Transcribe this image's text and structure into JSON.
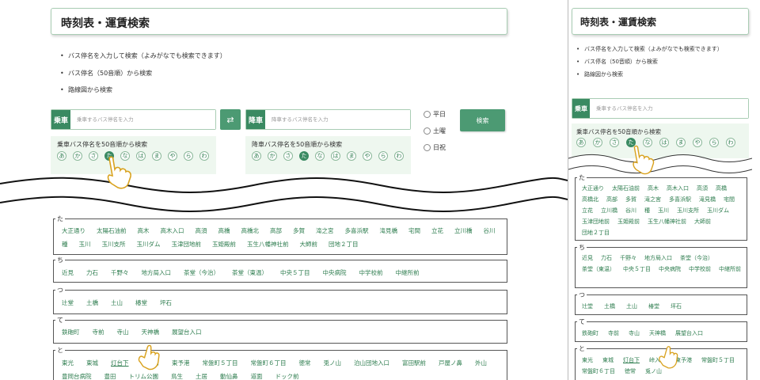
{
  "title": "時刻表・運賃検索",
  "bullets": [
    "バス停名を入力して検索（よみがなでも検索できます）",
    "バス停名（50音順）から検索",
    "路線図から検索"
  ],
  "board": {
    "label": "乗車",
    "placeholder": "乗車するバス停名を入力",
    "kana_title": "乗車バス停名を50音順から検索"
  },
  "alight": {
    "label": "降車",
    "placeholder": "降車するバス停名を入力",
    "kana_title": "降車バス停名を50音順から検索"
  },
  "swap_icon": "⇄",
  "radios": [
    "平日",
    "土曜",
    "日祝"
  ],
  "search_button": "検索",
  "kana": [
    "あ",
    "か",
    "さ",
    "た",
    "な",
    "は",
    "ま",
    "や",
    "ら",
    "わ"
  ],
  "kana_selected": "た",
  "sections": [
    {
      "label": "た",
      "stops": [
        "大正通り",
        "太陽石油前",
        "高木",
        "高木入口",
        "高須",
        "高橋",
        "高橋北",
        "高部",
        "多賀",
        "滝之宮",
        "多喜浜駅",
        "滝見橋",
        "宅間",
        "立花",
        "立川橋",
        "谷川",
        "種",
        "玉川",
        "玉川支所",
        "玉川ダム",
        "玉津団地前",
        "玉姫殿前",
        "玉生八幡神社前",
        "大師前",
        "団地２丁目"
      ]
    },
    {
      "label": "ち",
      "stops": [
        "近見",
        "力石",
        "千野々",
        "地方局入口",
        "茶堂（今治）",
        "茶堂（東温）",
        "中央５丁目",
        "中央病院",
        "中学校前",
        "中継所前"
      ]
    },
    {
      "label": "つ",
      "stops": [
        "辻堂",
        "土橋",
        "土山",
        "椿堂",
        "坪石"
      ]
    },
    {
      "label": "て",
      "stops": [
        "鉄砲町",
        "寺前",
        "寺山",
        "天神橋",
        "展望台入口"
      ]
    },
    {
      "label": "と",
      "stops": [
        "東光",
        "東城",
        "灯台下",
        "峠入口",
        "東予港",
        "常盤町５丁目",
        "常盤町６丁目",
        "徳常",
        "兎ノ山",
        "泊山団地入口",
        "富田駅前",
        "戸屋ノ鼻",
        "外山",
        "豊岡台病院",
        "豊田",
        "トリム公園",
        "鳥生",
        "土居",
        "動仙鼻",
        "道面",
        "ドック前"
      ]
    }
  ],
  "mobile_sections": [
    {
      "label": "た",
      "stops": [
        "大正通り",
        "太陽石油前",
        "高木",
        "高木入口",
        "高須",
        "高橋",
        "高橋北",
        "高部",
        "多賀",
        "滝之宮",
        "多喜浜駅",
        "滝見橋",
        "宅間",
        "立花",
        "立川橋",
        "谷川",
        "種",
        "玉川",
        "玉川支所",
        "玉川ダム",
        "玉津団地前",
        "玉姫殿前",
        "玉生八幡神社前",
        "大師前",
        "団地２丁目"
      ]
    },
    {
      "label": "ち",
      "stops": [
        "近見",
        "力石",
        "千野々",
        "地方局入口",
        "茶堂（今治）",
        "茶堂（東温）",
        "中央５丁目",
        "中央病院",
        "中学校前",
        "中継所前"
      ]
    },
    {
      "label": "つ",
      "stops": [
        "辻堂",
        "土橋",
        "土山",
        "椿堂",
        "坪石"
      ]
    },
    {
      "label": "て",
      "stops": [
        "鉄砲町",
        "寺前",
        "寺山",
        "天神橋",
        "展望台入口"
      ]
    },
    {
      "label": "と",
      "stops": [
        "東光",
        "東城",
        "灯台下",
        "峠入口",
        "東予港",
        "常盤町５丁目",
        "常盤町６丁目",
        "徳常",
        "兎ノ山"
      ]
    }
  ],
  "colors": {
    "accent": "#3a8a62",
    "panel": "#eef7ef",
    "link": "#2e7d4f"
  }
}
